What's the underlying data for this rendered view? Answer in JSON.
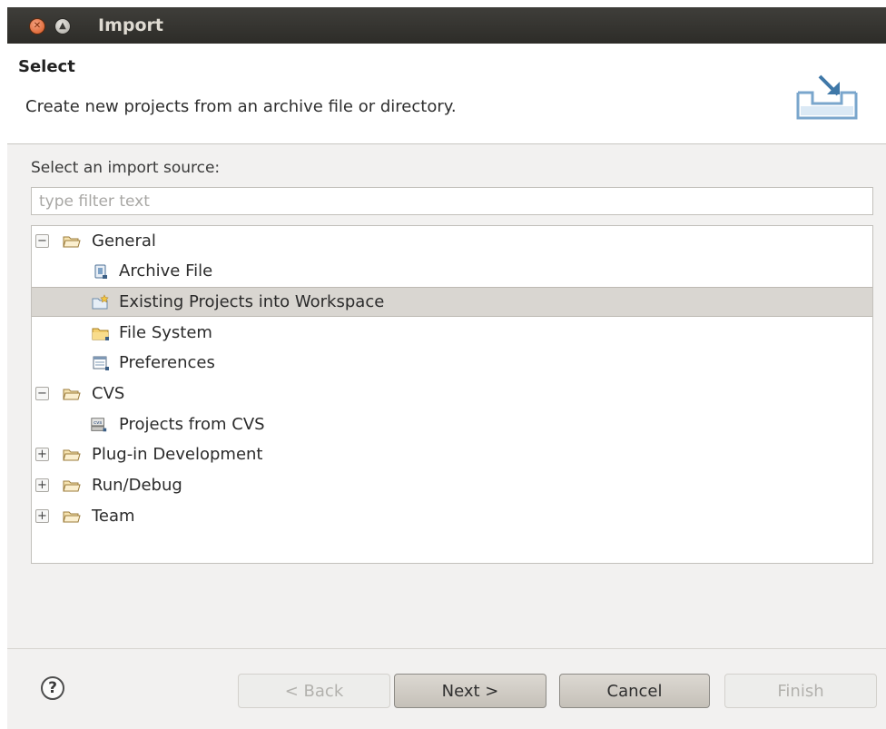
{
  "window": {
    "title": "Import"
  },
  "header": {
    "title": "Select",
    "description": "Create new projects from an archive file or directory."
  },
  "source_label": "Select an import source:",
  "filter": {
    "placeholder": "type filter text",
    "value": ""
  },
  "tree": {
    "items": [
      {
        "label": "General",
        "expander": "−",
        "icon": "folder-icon"
      },
      {
        "label": "Archive File",
        "icon": "archive-file-icon"
      },
      {
        "label": "Existing Projects into Workspace",
        "icon": "existing-projects-icon",
        "selected": true
      },
      {
        "label": "File System",
        "icon": "file-system-icon"
      },
      {
        "label": "Preferences",
        "icon": "preferences-icon"
      },
      {
        "label": "CVS",
        "expander": "−",
        "icon": "folder-icon"
      },
      {
        "label": "Projects from CVS",
        "icon": "cvs-icon"
      },
      {
        "label": "Plug-in Development",
        "expander": "+",
        "icon": "folder-icon"
      },
      {
        "label": "Run/Debug",
        "expander": "+",
        "icon": "folder-icon"
      },
      {
        "label": "Team",
        "expander": "+",
        "icon": "folder-icon"
      }
    ]
  },
  "buttons": {
    "help": "?",
    "back": "< Back",
    "next": "Next >",
    "cancel": "Cancel",
    "finish": "Finish"
  },
  "colors": {
    "titlebar": "#3a3935",
    "dialog_background": "#f2f1f0",
    "selection": "#d9d6d1",
    "folder": "#f0c060"
  }
}
